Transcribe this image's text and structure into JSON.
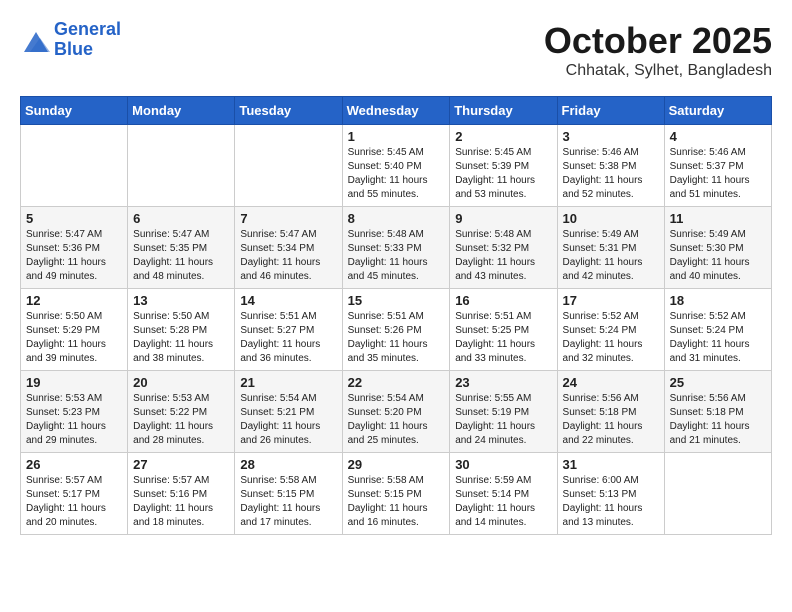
{
  "header": {
    "logo_line1": "General",
    "logo_line2": "Blue",
    "month": "October 2025",
    "location": "Chhatak, Sylhet, Bangladesh"
  },
  "weekdays": [
    "Sunday",
    "Monday",
    "Tuesday",
    "Wednesday",
    "Thursday",
    "Friday",
    "Saturday"
  ],
  "weeks": [
    [
      {
        "day": "",
        "info": ""
      },
      {
        "day": "",
        "info": ""
      },
      {
        "day": "",
        "info": ""
      },
      {
        "day": "1",
        "info": "Sunrise: 5:45 AM\nSunset: 5:40 PM\nDaylight: 11 hours\nand 55 minutes."
      },
      {
        "day": "2",
        "info": "Sunrise: 5:45 AM\nSunset: 5:39 PM\nDaylight: 11 hours\nand 53 minutes."
      },
      {
        "day": "3",
        "info": "Sunrise: 5:46 AM\nSunset: 5:38 PM\nDaylight: 11 hours\nand 52 minutes."
      },
      {
        "day": "4",
        "info": "Sunrise: 5:46 AM\nSunset: 5:37 PM\nDaylight: 11 hours\nand 51 minutes."
      }
    ],
    [
      {
        "day": "5",
        "info": "Sunrise: 5:47 AM\nSunset: 5:36 PM\nDaylight: 11 hours\nand 49 minutes."
      },
      {
        "day": "6",
        "info": "Sunrise: 5:47 AM\nSunset: 5:35 PM\nDaylight: 11 hours\nand 48 minutes."
      },
      {
        "day": "7",
        "info": "Sunrise: 5:47 AM\nSunset: 5:34 PM\nDaylight: 11 hours\nand 46 minutes."
      },
      {
        "day": "8",
        "info": "Sunrise: 5:48 AM\nSunset: 5:33 PM\nDaylight: 11 hours\nand 45 minutes."
      },
      {
        "day": "9",
        "info": "Sunrise: 5:48 AM\nSunset: 5:32 PM\nDaylight: 11 hours\nand 43 minutes."
      },
      {
        "day": "10",
        "info": "Sunrise: 5:49 AM\nSunset: 5:31 PM\nDaylight: 11 hours\nand 42 minutes."
      },
      {
        "day": "11",
        "info": "Sunrise: 5:49 AM\nSunset: 5:30 PM\nDaylight: 11 hours\nand 40 minutes."
      }
    ],
    [
      {
        "day": "12",
        "info": "Sunrise: 5:50 AM\nSunset: 5:29 PM\nDaylight: 11 hours\nand 39 minutes."
      },
      {
        "day": "13",
        "info": "Sunrise: 5:50 AM\nSunset: 5:28 PM\nDaylight: 11 hours\nand 38 minutes."
      },
      {
        "day": "14",
        "info": "Sunrise: 5:51 AM\nSunset: 5:27 PM\nDaylight: 11 hours\nand 36 minutes."
      },
      {
        "day": "15",
        "info": "Sunrise: 5:51 AM\nSunset: 5:26 PM\nDaylight: 11 hours\nand 35 minutes."
      },
      {
        "day": "16",
        "info": "Sunrise: 5:51 AM\nSunset: 5:25 PM\nDaylight: 11 hours\nand 33 minutes."
      },
      {
        "day": "17",
        "info": "Sunrise: 5:52 AM\nSunset: 5:24 PM\nDaylight: 11 hours\nand 32 minutes."
      },
      {
        "day": "18",
        "info": "Sunrise: 5:52 AM\nSunset: 5:24 PM\nDaylight: 11 hours\nand 31 minutes."
      }
    ],
    [
      {
        "day": "19",
        "info": "Sunrise: 5:53 AM\nSunset: 5:23 PM\nDaylight: 11 hours\nand 29 minutes."
      },
      {
        "day": "20",
        "info": "Sunrise: 5:53 AM\nSunset: 5:22 PM\nDaylight: 11 hours\nand 28 minutes."
      },
      {
        "day": "21",
        "info": "Sunrise: 5:54 AM\nSunset: 5:21 PM\nDaylight: 11 hours\nand 26 minutes."
      },
      {
        "day": "22",
        "info": "Sunrise: 5:54 AM\nSunset: 5:20 PM\nDaylight: 11 hours\nand 25 minutes."
      },
      {
        "day": "23",
        "info": "Sunrise: 5:55 AM\nSunset: 5:19 PM\nDaylight: 11 hours\nand 24 minutes."
      },
      {
        "day": "24",
        "info": "Sunrise: 5:56 AM\nSunset: 5:18 PM\nDaylight: 11 hours\nand 22 minutes."
      },
      {
        "day": "25",
        "info": "Sunrise: 5:56 AM\nSunset: 5:18 PM\nDaylight: 11 hours\nand 21 minutes."
      }
    ],
    [
      {
        "day": "26",
        "info": "Sunrise: 5:57 AM\nSunset: 5:17 PM\nDaylight: 11 hours\nand 20 minutes."
      },
      {
        "day": "27",
        "info": "Sunrise: 5:57 AM\nSunset: 5:16 PM\nDaylight: 11 hours\nand 18 minutes."
      },
      {
        "day": "28",
        "info": "Sunrise: 5:58 AM\nSunset: 5:15 PM\nDaylight: 11 hours\nand 17 minutes."
      },
      {
        "day": "29",
        "info": "Sunrise: 5:58 AM\nSunset: 5:15 PM\nDaylight: 11 hours\nand 16 minutes."
      },
      {
        "day": "30",
        "info": "Sunrise: 5:59 AM\nSunset: 5:14 PM\nDaylight: 11 hours\nand 14 minutes."
      },
      {
        "day": "31",
        "info": "Sunrise: 6:00 AM\nSunset: 5:13 PM\nDaylight: 11 hours\nand 13 minutes."
      },
      {
        "day": "",
        "info": ""
      }
    ]
  ]
}
